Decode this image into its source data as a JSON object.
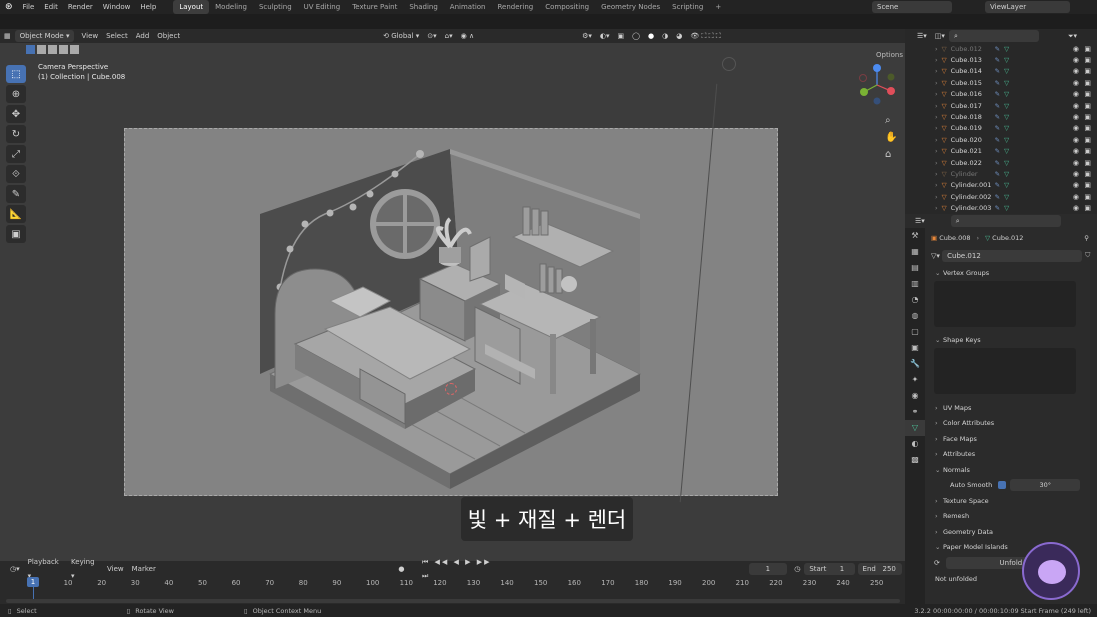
{
  "menu": {
    "items": [
      "File",
      "Edit",
      "Render",
      "Window",
      "Help"
    ]
  },
  "workspaces": {
    "tabs": [
      "Layout",
      "Modeling",
      "Sculpting",
      "UV Editing",
      "Texture Paint",
      "Shading",
      "Animation",
      "Rendering",
      "Compositing",
      "Geometry Nodes",
      "Scripting"
    ],
    "active": "Layout"
  },
  "scene": {
    "name": "Scene",
    "view_layer": "ViewLayer"
  },
  "viewport_header": {
    "mode": "Object Mode",
    "menus": [
      "View",
      "Select",
      "Add",
      "Object"
    ],
    "transform": "Global",
    "options": "Options"
  },
  "viewport": {
    "view_name": "Camera Perspective",
    "collection": "(1) Collection | Cube.008"
  },
  "subtitle": "빛 + 재질 + 렌더",
  "timeline": {
    "menus": [
      "Playback",
      "Keying",
      "View",
      "Marker"
    ],
    "current_frame": "1",
    "start_label": "Start",
    "start": "1",
    "end_label": "End",
    "end": "250",
    "ticks": [
      "1",
      "10",
      "20",
      "30",
      "40",
      "50",
      "60",
      "70",
      "80",
      "90",
      "100",
      "110",
      "120",
      "130",
      "140",
      "150",
      "160",
      "170",
      "180",
      "190",
      "200",
      "210",
      "220",
      "230",
      "240",
      "250"
    ]
  },
  "statusbar": {
    "select": "Select",
    "rotate": "Rotate View",
    "context": "Object Context Menu",
    "info": "3.2.2  00:00:00:00 / 00:00:10:09  Start Frame (249 left)"
  },
  "outliner": {
    "items": [
      "Cube.012",
      "Cube.013",
      "Cube.014",
      "Cube.015",
      "Cube.016",
      "Cube.017",
      "Cube.018",
      "Cube.019",
      "Cube.020",
      "Cube.021",
      "Cube.022",
      "Cylinder",
      "Cylinder.001",
      "Cylinder.002",
      "Cylinder.003"
    ],
    "faded": [
      "Cube.012",
      "Cylinder"
    ]
  },
  "properties": {
    "breadcrumb_object": "Cube.008",
    "breadcrumb_mesh": "Cube.012",
    "mesh_name": "Cube.012",
    "sections": [
      "Vertex Groups",
      "Shape Keys",
      "UV Maps",
      "Color Attributes",
      "Face Maps",
      "Attributes",
      "Normals",
      "Texture Space",
      "Remesh",
      "Geometry Data",
      "Paper Model Islands"
    ],
    "auto_smooth_label": "Auto Smooth",
    "auto_smooth_angle": "30°",
    "unfold_label": "Unfold",
    "not_unfolded": "Not unfolded"
  },
  "colors": {
    "accent": "#4772b3",
    "active_frame": "#4772b3",
    "mesh_orange": "#e8883a",
    "vertex_green": "#4cc39a"
  }
}
